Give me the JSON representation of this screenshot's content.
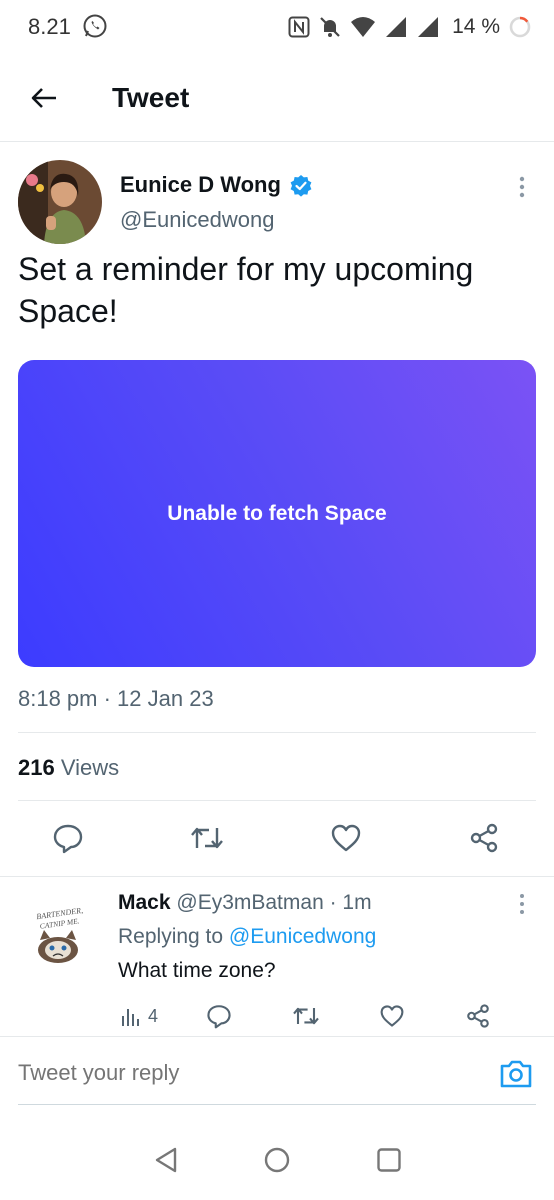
{
  "status_bar": {
    "time": "8.21",
    "battery": "14 %",
    "icons": [
      "whatsapp-icon",
      "nfc-icon",
      "mute-icon",
      "wifi-icon",
      "signal-icon",
      "battery-ring-icon"
    ]
  },
  "header": {
    "title": "Tweet",
    "back_icon": "arrow-left-icon"
  },
  "tweet": {
    "author_name": "Eunice D Wong",
    "author_handle": "@Eunicedwong",
    "verified": true,
    "text": "Set a reminder for my upcoming Space!",
    "space_card_label": "Unable to fetch Space",
    "timestamp": "8:18 pm · 12 Jan 23",
    "views_count": "216",
    "views_label": "Views",
    "actions": [
      "reply-icon",
      "retweet-icon",
      "like-icon",
      "share-icon"
    ]
  },
  "reply": {
    "name": "Mack",
    "meta": "@Ey3mBatman · 1m",
    "replying_prefix": "Replying to",
    "replying_to": "@Eunicedwong",
    "text": "What time zone?",
    "avatar_caption": "BARTENDER, CATNIP ME.",
    "views": "4"
  },
  "composer": {
    "placeholder": "Tweet your reply"
  },
  "colors": {
    "accent": "#1d9bf0",
    "text": "#0f1419",
    "muted": "#536471",
    "card_gradient_start": "#3c3cff",
    "card_gradient_end": "#7b52f5"
  }
}
